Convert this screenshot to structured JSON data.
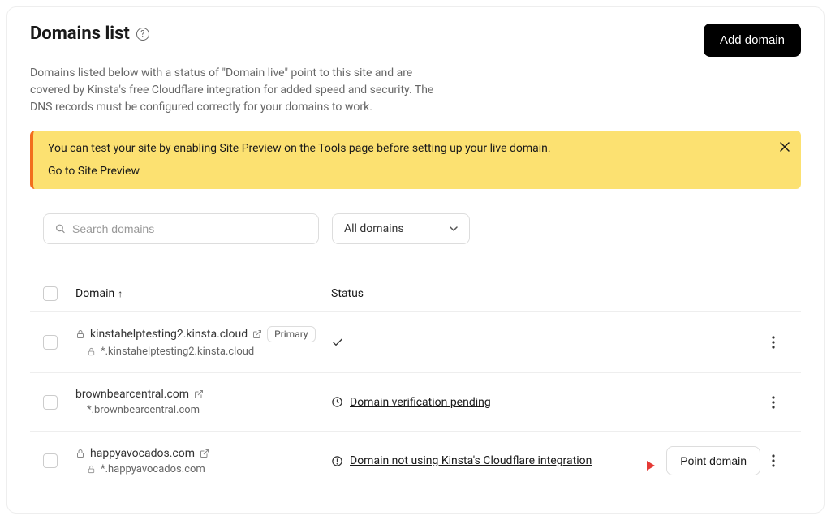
{
  "header": {
    "title": "Domains list",
    "add_button": "Add domain",
    "description": "Domains listed below with a status of \"Domain live\" point to this site and are covered by Kinsta's free Cloudflare integration for added speed and security. The DNS records must be configured correctly for your domains to work."
  },
  "alert": {
    "message": "You can test your site by enabling Site Preview on the Tools page before setting up your live domain.",
    "link_label": "Go to Site Preview"
  },
  "controls": {
    "search_placeholder": "Search domains",
    "filter_label": "All domains"
  },
  "table": {
    "col_domain": "Domain",
    "col_status": "Status"
  },
  "rows": [
    {
      "domain": "kinstahelptesting2.kinsta.cloud",
      "wildcard": "*.kinstahelptesting2.kinsta.cloud",
      "primary_badge": "Primary",
      "locked": true,
      "wildcard_locked": true,
      "status_kind": "check",
      "status_text": "",
      "action_button": "",
      "show_arrow": false,
      "external": true
    },
    {
      "domain": "brownbearcentral.com",
      "wildcard": "*.brownbearcentral.com",
      "primary_badge": "",
      "locked": false,
      "wildcard_locked": false,
      "status_kind": "pending",
      "status_text": "Domain verification pending",
      "action_button": "",
      "show_arrow": false,
      "external": true
    },
    {
      "domain": "happyavocados.com",
      "wildcard": "*.happyavocados.com",
      "primary_badge": "",
      "locked": true,
      "wildcard_locked": true,
      "status_kind": "warn",
      "status_text": "Domain not using Kinsta's Cloudflare integration",
      "action_button": "Point domain",
      "show_arrow": true,
      "external": true
    }
  ]
}
